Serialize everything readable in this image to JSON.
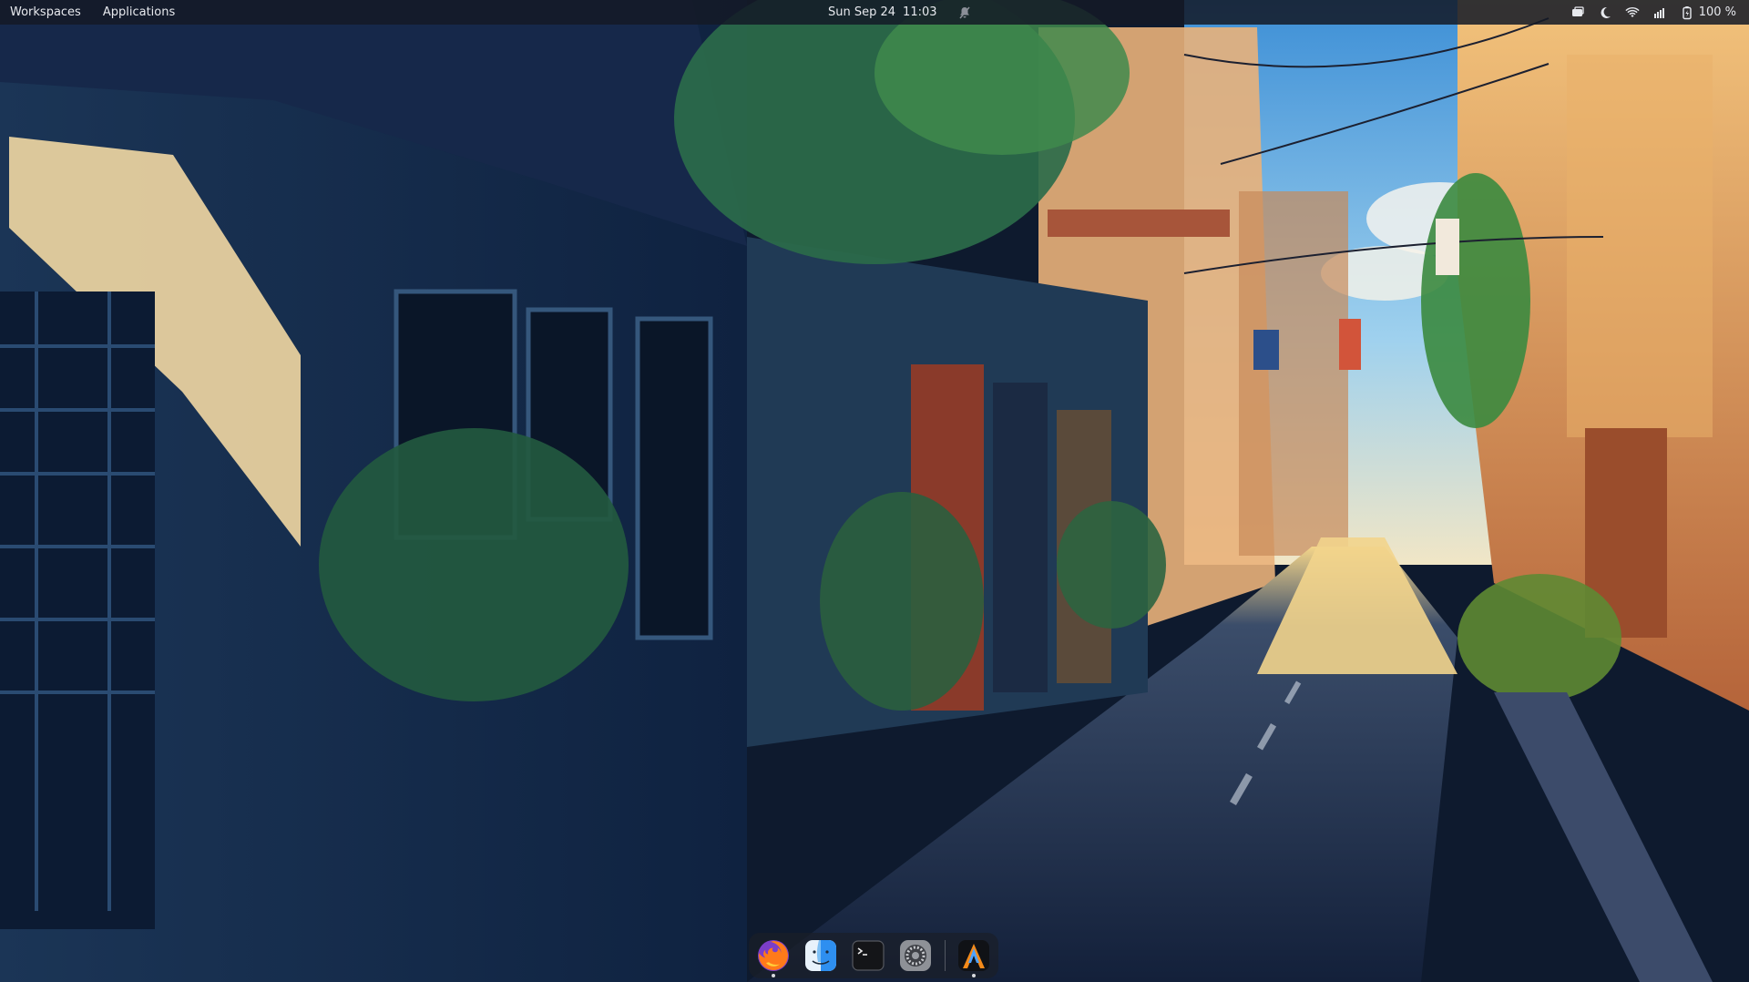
{
  "topbar": {
    "workspaces_label": "Workspaces",
    "applications_label": "Applications",
    "date": "Sun Sep 24",
    "time": "11:03",
    "battery_percent": "100 %",
    "icons": [
      "notifications-off-icon",
      "screen-share-icon",
      "night-light-icon",
      "wifi-icon",
      "volume-icon",
      "battery-icon"
    ]
  },
  "dock": {
    "apps": [
      {
        "name": "Firefox",
        "icon": "firefox-icon",
        "running": true
      },
      {
        "name": "Finder",
        "icon": "finder-icon",
        "running": false
      },
      {
        "name": "Terminal",
        "icon": "terminal-icon",
        "running": false
      },
      {
        "name": "Settings",
        "icon": "settings-icon",
        "running": false
      },
      {
        "name": "Tiling",
        "icon": "tiling-app-icon",
        "running": true
      }
    ]
  },
  "colors": {
    "bar_bg": "#141a26",
    "bar_text": "#e7e9ee",
    "sky": "#5ea9e0",
    "street": "#1f2f4a",
    "sunlit_wall": "#f0b46a"
  }
}
